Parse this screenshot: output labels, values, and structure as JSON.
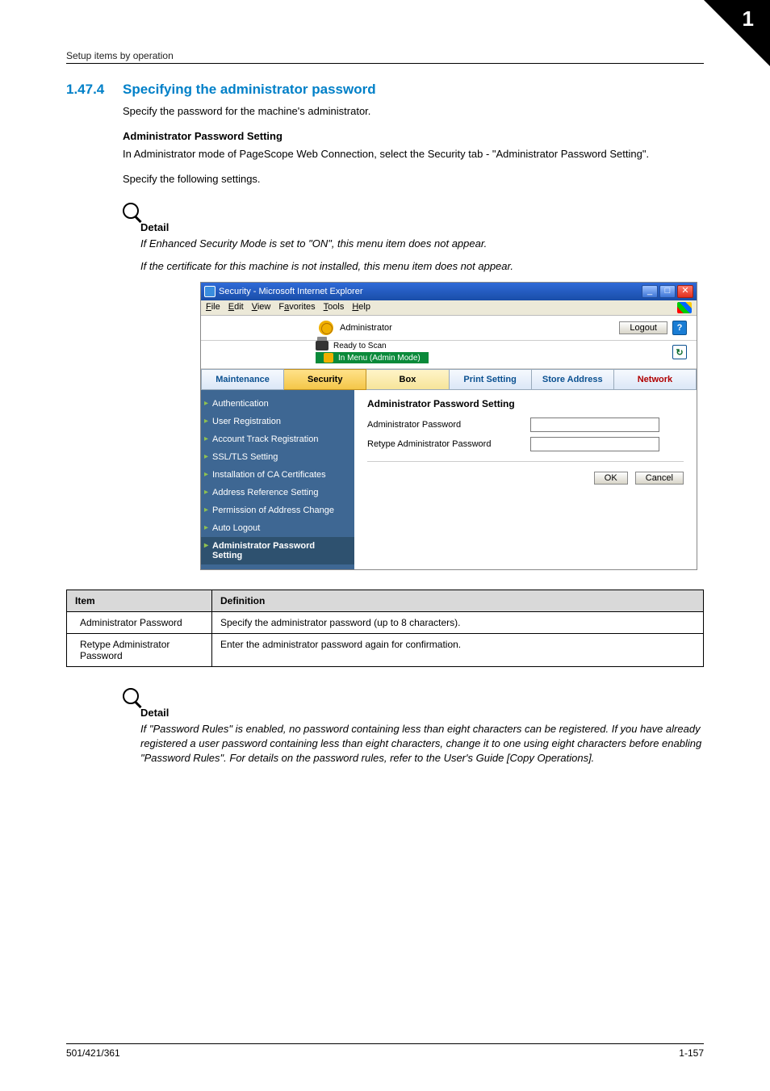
{
  "runningHead": {
    "left": "Setup items by operation",
    "number": "1"
  },
  "section": {
    "number": "1.47.4",
    "title": "Specifying the administrator password"
  },
  "intro": "Specify the password for the machine's administrator.",
  "subhead": "Administrator Password Setting",
  "para1": "In Administrator mode of PageScope Web Connection, select the Security tab - \"Administrator Password Setting\".",
  "para2": "Specify the following settings.",
  "detail1": {
    "label": "Detail",
    "line1": "If Enhanced Security Mode is set to \"ON\", this menu item does not appear.",
    "line2": "If the certificate for this machine is not installed, this menu item does not appear."
  },
  "screenshot": {
    "windowTitle": "Security - Microsoft Internet Explorer",
    "menus": {
      "file": "File",
      "edit": "Edit",
      "view": "View",
      "favorites": "Favorites",
      "tools": "Tools",
      "help": "Help"
    },
    "headerUser": "Administrator",
    "logout": "Logout",
    "helpGlyph": "?",
    "statusReady": "Ready to Scan",
    "statusMode": "In Menu (Admin Mode)",
    "refreshGlyph": "↻",
    "tabs": {
      "maintenance": "Maintenance",
      "security": "Security",
      "box": "Box",
      "printSetting": "Print Setting",
      "storeAddress": "Store Address",
      "network": "Network"
    },
    "sidenav": {
      "auth": "Authentication",
      "userReg": "User Registration",
      "acctTrack": "Account Track Registration",
      "ssl": "SSL/TLS Setting",
      "cacert": "Installation of CA Certificates",
      "addrRef": "Address Reference Setting",
      "permAddr": "Permission of Address Change",
      "autoLogout": "Auto Logout",
      "adminPw": "Administrator Password Setting"
    },
    "form": {
      "heading": "Administrator Password Setting",
      "label1": "Administrator Password",
      "label2": "Retype Administrator Password",
      "ok": "OK",
      "cancel": "Cancel"
    },
    "winbtns": {
      "min": "_",
      "max": "□",
      "close": "✕"
    }
  },
  "table": {
    "headItem": "Item",
    "headDef": "Definition",
    "rows": [
      {
        "item": "Administrator Password",
        "def": "Specify the administrator password (up to 8 characters)."
      },
      {
        "item": "Retype Administrator Password",
        "def": "Enter the administrator password again for confirmation."
      }
    ]
  },
  "detail2": {
    "label": "Detail",
    "text": "If \"Password Rules\" is enabled, no password containing less than eight characters can be registered. If you have already registered a user password containing less than eight characters, change it to one using eight characters before enabling \"Password Rules\". For details on the password rules, refer to the User's Guide [Copy Operations]."
  },
  "footer": {
    "left": "501/421/361",
    "right": "1-157"
  }
}
